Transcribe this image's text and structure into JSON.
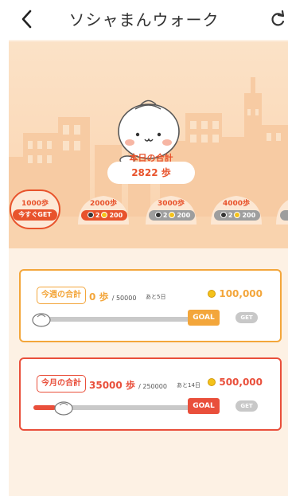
{
  "header": {
    "title": "ソシャまんウォーク"
  },
  "today": {
    "label": "本日の合計",
    "steps": "2822 歩"
  },
  "milestones": [
    {
      "label": "1000歩",
      "button": "今すぐGET"
    },
    {
      "label": "2000歩",
      "stamps": "2",
      "coins": "200",
      "state": "active"
    },
    {
      "label": "3000歩",
      "stamps": "2",
      "coins": "200",
      "state": "locked"
    },
    {
      "label": "4000歩",
      "stamps": "2",
      "coins": "200",
      "state": "locked"
    }
  ],
  "weekly": {
    "tag": "今週の合計",
    "steps": "0 歩",
    "goal": "/ 50000",
    "remaining": "あと5日",
    "reward": "100,000",
    "progress": 0,
    "goal_label": "GOAL",
    "get_label": "GET"
  },
  "monthly": {
    "tag": "今月の合計",
    "steps": "35000 歩",
    "goal": "/ 250000",
    "remaining": "あと14日",
    "reward": "500,000",
    "progress": 0.14,
    "goal_label": "GOAL",
    "get_label": "GET"
  },
  "colors": {
    "accent_red": "#e94f3b",
    "accent_orange": "#f3a63b",
    "hero_bg": "#fbdcbc",
    "coin": "#f4c21a"
  },
  "icons": {
    "back": "chevron-left-icon",
    "refresh": "refresh-icon",
    "mascot": "bun-mascot",
    "coin": "coin-icon"
  }
}
